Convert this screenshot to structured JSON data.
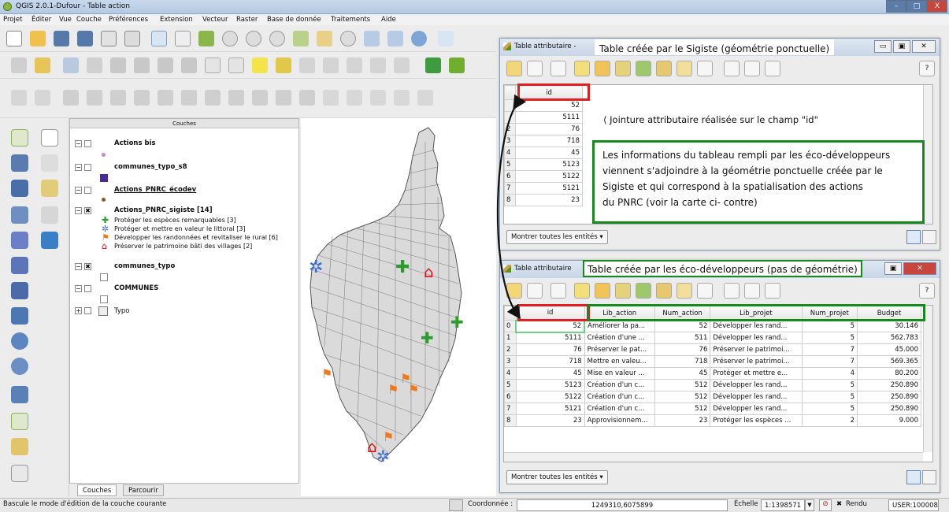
{
  "window": {
    "title": "QGIS 2.0.1-Dufour - Table action",
    "min": "–",
    "max": "□",
    "close": "X"
  },
  "menu": [
    "Projet",
    "Éditer",
    "Vue",
    "Couche",
    "Préférences",
    "Extension",
    "Vecteur",
    "Raster",
    "Base de donnée",
    "Traitements",
    "Aide"
  ],
  "layers_panel": {
    "title": "Couches",
    "layers": [
      {
        "name": "Actions bis",
        "bold": true
      },
      {
        "name": "communes_typo_s8",
        "bold": true
      },
      {
        "name": "Actions_PNRC_écodev",
        "bold": true
      },
      {
        "name": "Actions_PNRC_sigiste [14]",
        "bold": true
      },
      {
        "name": "communes_typo",
        "bold": true
      },
      {
        "name": "COMMUNES",
        "bold": true
      },
      {
        "name": "Typo",
        "bold": false
      }
    ],
    "legend": [
      {
        "label": "Protéger les espèces remarquables [3]",
        "color": "#2a9d2a"
      },
      {
        "label": "Protéger et mettre en valeur le littoral  [3]",
        "color": "#3a6fd8"
      },
      {
        "label": "Développer les randonnées et revitaliser le rural [6]",
        "color": "#f07a1a"
      },
      {
        "label": "Préserver le patrimoine bâti des villages [2]",
        "color": "#e01010"
      }
    ],
    "tabs": [
      "Couches",
      "Parcourir"
    ]
  },
  "status": {
    "message": "Bascule le mode d'édition de la couche courante",
    "coord_label": "Coordonnée :",
    "coord_value": "1249310,6075899",
    "scale_label": "Échelle",
    "scale_value": "1:1398571",
    "render_label": "Rendu",
    "user": "USER:100008"
  },
  "table1": {
    "window_label": "Table attributaire -",
    "annotation": "Table  créée par le Sigiste (géométrie ponctuelle)",
    "col": "id",
    "rows": [
      {
        "n": "",
        "id": "52"
      },
      {
        "n": "",
        "id": "5111"
      },
      {
        "n": "2",
        "id": "76"
      },
      {
        "n": "3",
        "id": "718"
      },
      {
        "n": "4",
        "id": "45"
      },
      {
        "n": "5",
        "id": "5123"
      },
      {
        "n": "6",
        "id": "5122"
      },
      {
        "n": "7",
        "id": "5121"
      },
      {
        "n": "8",
        "id": "23"
      }
    ],
    "show_all": "Montrer toutes les entités",
    "help": "?"
  },
  "table2": {
    "window_label": "Table attributaire",
    "annotation": "Table  créée par les éco-développeurs (pas de géométrie)",
    "cols": [
      "id",
      "Lib_action",
      "Num_action",
      "Lib_projet",
      "Num_projet",
      "Budget"
    ],
    "rows": [
      [
        "0",
        "52",
        "Améliorer la pa...",
        "52",
        "Développer les rand...",
        "5",
        "30.146"
      ],
      [
        "1",
        "5111",
        "Création d'une ...",
        "511",
        "Développer les rand...",
        "5",
        "562.783"
      ],
      [
        "2",
        "76",
        "Préserver le pat...",
        "76",
        "Préserver le patrimoi...",
        "7",
        "45.000"
      ],
      [
        "3",
        "718",
        "Mettre en valeu...",
        "718",
        "Préserver le patrimoi...",
        "7",
        "569.365"
      ],
      [
        "4",
        "45",
        "Mise en valeur ...",
        "45",
        "Protéger et mettre e...",
        "4",
        "80.200"
      ],
      [
        "5",
        "5123",
        "Création d'un c...",
        "512",
        "Développer les rand...",
        "5",
        "250.890"
      ],
      [
        "6",
        "5122",
        "Création d'un c...",
        "512",
        "Développer les rand...",
        "5",
        "250.890"
      ],
      [
        "7",
        "5121",
        "Création d'un c...",
        "512",
        "Développer les rand...",
        "5",
        "250.890"
      ],
      [
        "8",
        "23",
        "Approvisionnem...",
        "23",
        "Protéger les espèces ...",
        "2",
        "9.000"
      ]
    ],
    "show_all": "Montrer toutes les entités",
    "help": "?"
  },
  "join_note": "Jointure attributaire réalisée sur le champ \"id\"",
  "info": {
    "line1": "Les informations du tableau rempli par les éco-développeurs",
    "line2": "viennent s'adjoindre à la géométrie ponctuelle créée par le",
    "line3": "Sigiste et qui correspond à la spatialisation des actions",
    "line4": "du PNRC (voir la carte ci- contre)"
  }
}
